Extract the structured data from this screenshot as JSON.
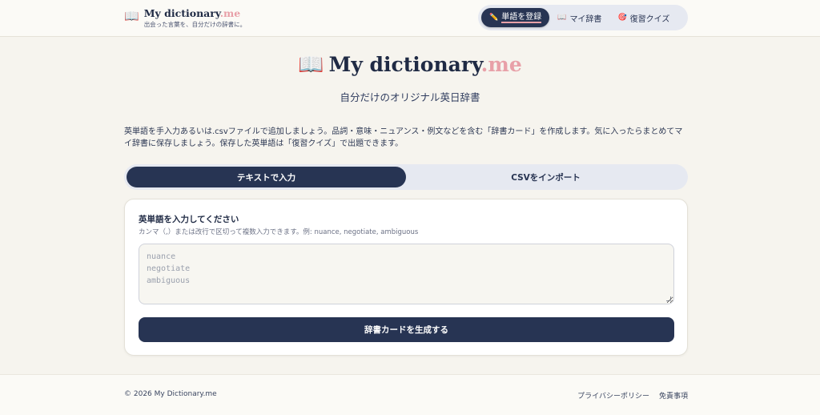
{
  "header": {
    "brand_icon": "book-icon",
    "brand_name": "My dictionary",
    "brand_suffix": ".me",
    "brand_tagline": "出会った言葉を、自分だけの辞書に。",
    "nav": [
      {
        "icon": "pencil-icon",
        "label": "単語を登録",
        "active": true
      },
      {
        "icon": "book-icon",
        "label": "マイ辞書",
        "active": false
      },
      {
        "icon": "target-icon",
        "label": "復習クイズ",
        "active": false
      }
    ]
  },
  "hero": {
    "title": "My dictionary",
    "title_suffix": ".me",
    "subtitle": "自分だけのオリジナル英日辞書",
    "intro": "英単語を手入力あるいは.csvファイルで追加しましょう。品詞・意味・ニュアンス・例文などを含む「辞書カード」を作成します。気に入ったらまとめてマイ辞書に保存しましょう。保存した英単語は「復習クイズ」で出題できます。"
  },
  "tabs": [
    {
      "label": "テキストで入力",
      "active": true
    },
    {
      "label": "CSVをインポート",
      "active": false
    }
  ],
  "form": {
    "title": "英単語を入力してください",
    "hint": "カンマ（,）または改行で区切って複数入力できます。例: nuance, negotiate, ambiguous",
    "textarea_value": "",
    "textarea_placeholder": "nuance\nnegotiate\nambiguous",
    "submit_label": "辞書カードを生成する"
  },
  "footer": {
    "copyright": "© 2026 My Dictionary.me",
    "links": [
      "プライバシーポリシー",
      "免責事項"
    ]
  },
  "colors": {
    "primary": "#273453",
    "accent": "#e8a0a8",
    "background": "#f6f4ee"
  }
}
